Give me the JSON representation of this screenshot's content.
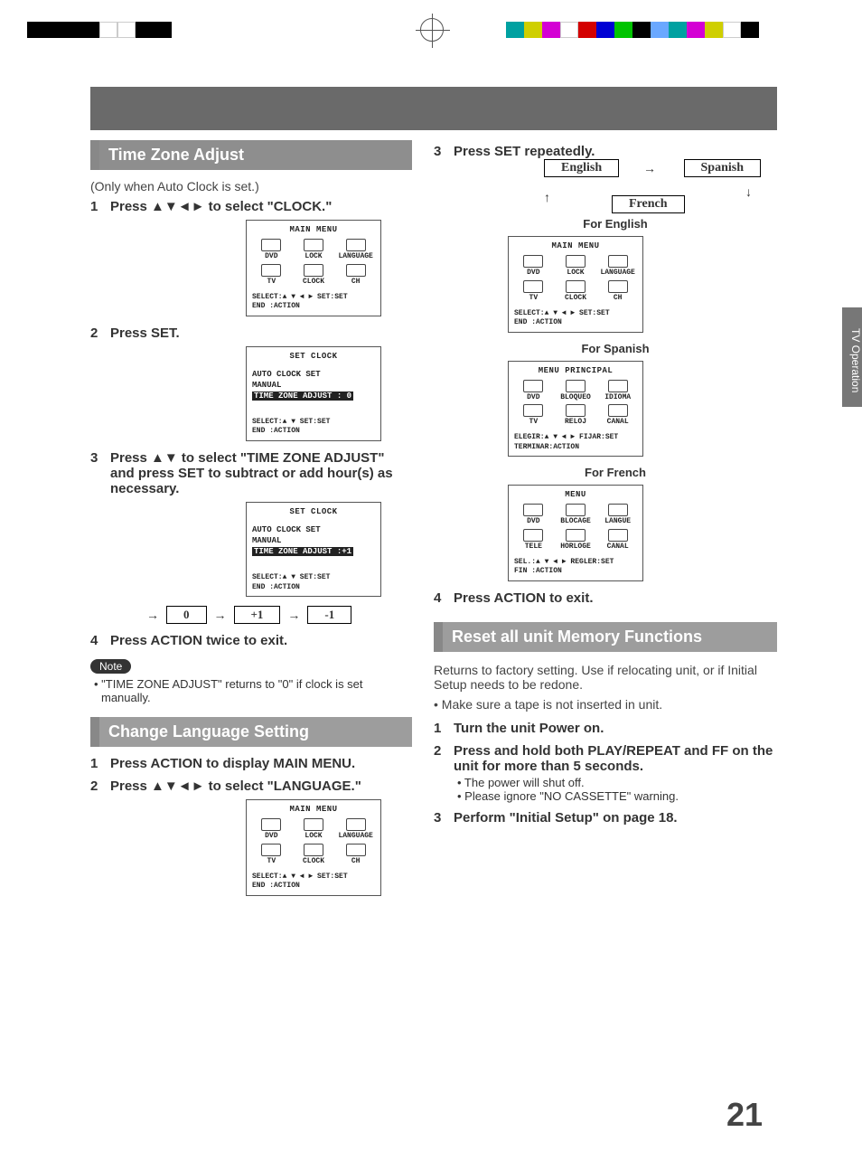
{
  "colorbars": {
    "left": [
      "#000",
      "#000",
      "#000",
      "#000",
      "#fff",
      "#fff",
      "#000",
      "#000"
    ],
    "right": [
      "#00a1a1",
      "#cfcf00",
      "#d400d4",
      "#fff",
      "#d40000",
      "#0000d4",
      "#00c400",
      "#000",
      "#6aa8ff",
      "#00a1a1",
      "#d400d4",
      "#cfcf00",
      "#fff",
      "#000"
    ]
  },
  "side_tab": "TV Operation",
  "page_number": "21",
  "left": {
    "section1": {
      "title": "Time Zone Adjust",
      "subtitle": "(Only when Auto Clock is set.)",
      "steps": [
        {
          "text": "Press ▲▼◄► to select \"CLOCK.\""
        },
        {
          "text": "Press SET."
        },
        {
          "text": "Press ▲▼ to select \"TIME ZONE ADJUST\" and press SET to subtract or add hour(s) as necessary."
        },
        {
          "text": "Press ACTION twice to exit."
        }
      ],
      "flow": {
        "a": "0",
        "b": "+1",
        "c": "-1"
      },
      "note_label": "Note",
      "note_text": "\"TIME ZONE ADJUST\" returns to \"0\" if clock is set manually."
    },
    "screen_main": {
      "title": "MAIN MENU",
      "cells": [
        "DVD",
        "LOCK",
        "LANGUAGE",
        "TV",
        "CLOCK",
        "CH"
      ],
      "foot1": "SELECT:▲ ▼ ◄ ►   SET:SET",
      "foot2": "END   :ACTION"
    },
    "screen_set1": {
      "title": "SET CLOCK",
      "line1": "AUTO CLOCK SET",
      "line2": "MANUAL",
      "line3": "TIME ZONE ADJUST : 0",
      "foot1": "SELECT:▲ ▼        SET:SET",
      "foot2": "END   :ACTION"
    },
    "screen_set2": {
      "title": "SET CLOCK",
      "line1": "AUTO CLOCK SET",
      "line2": "MANUAL",
      "line3": "TIME ZONE ADJUST :+1",
      "foot1": "SELECT:▲ ▼        SET:SET",
      "foot2": "END   :ACTION"
    },
    "section2": {
      "title": "Change Language Setting",
      "steps": [
        {
          "text": "Press ACTION to display MAIN MENU."
        },
        {
          "text": "Press ▲▼◄► to select \"LANGUAGE.\""
        }
      ]
    }
  },
  "right": {
    "step3": "Press SET repeatedly.",
    "cycle": {
      "a": "English",
      "b": "Spanish",
      "c": "French"
    },
    "caption_en": "For English",
    "caption_es": "For Spanish",
    "caption_fr": "For French",
    "screen_en": {
      "title": "MAIN MENU",
      "cells": [
        "DVD",
        "LOCK",
        "LANGUAGE",
        "TV",
        "CLOCK",
        "CH"
      ],
      "foot1": "SELECT:▲ ▼ ◄ ►   SET:SET",
      "foot2": "END   :ACTION"
    },
    "screen_es": {
      "title": "MENU PRINCIPAL",
      "cells": [
        "DVD",
        "BLOQUEO",
        "IDIOMA",
        "TV",
        "RELOJ",
        "CANAL"
      ],
      "foot1": "ELEGIR:▲ ▼ ◄ ►  FIJAR:SET",
      "foot2": "TERMINAR:ACTION"
    },
    "screen_fr": {
      "title": "MENU",
      "cells": [
        "DVD",
        "BLOCAGE",
        "LANGUE",
        "TELE",
        "HORLOGE",
        "CANAL"
      ],
      "foot1": "SEL.:▲ ▼ ◄ ► REGLER:SET",
      "foot2": "FIN   :ACTION"
    },
    "step4": "Press ACTION to exit.",
    "section3": {
      "title": "Reset all unit Memory Functions",
      "intro1": "Returns to factory setting. Use if relocating unit, or if Initial Setup needs to be redone.",
      "intro2": "• Make sure a tape is not inserted in unit.",
      "steps": [
        {
          "text": "Turn the unit Power on."
        },
        {
          "text": "Press and hold both PLAY/REPEAT and FF on the unit for more than 5 seconds.",
          "subs": [
            "• The power will shut off.",
            "• Please ignore \"NO CASSETTE\" warning."
          ]
        },
        {
          "text": "Perform \"Initial Setup\" on page 18."
        }
      ]
    }
  }
}
